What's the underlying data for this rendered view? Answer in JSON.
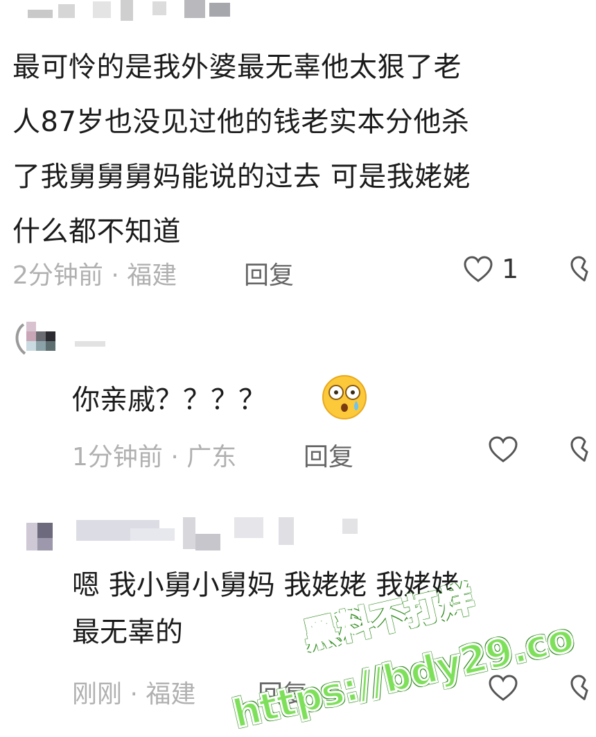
{
  "comment_1": {
    "lines": [
      "最可怜的是我外婆最无辜他太狠了老",
      "人87岁也没见过他的钱老实本分他杀",
      "了我舅舅舅妈能说的过去 可是我姥姥",
      "什么都不知道"
    ],
    "meta": "2分钟前 · 福建",
    "reply_label": "回复",
    "like_count": "1"
  },
  "comment_2": {
    "text": "你亲戚？？？？",
    "emoji": "flushed-face-emoji",
    "meta": "1分钟前 · 广东",
    "reply_label": "回复"
  },
  "comment_3": {
    "lines": [
      "嗯  我小舅小舅妈  我姥姥  我姥姥",
      "最无辜的"
    ],
    "meta": "刚刚 · 福建",
    "reply_label": "回复"
  },
  "watermark": {
    "line1": "黑料不打烊",
    "line2": "https://bdy29.co"
  },
  "icons": {
    "like": "heart-outline-icon",
    "dislike": "broken-heart-icon"
  },
  "colors": {
    "watermark_fill": "#7ee05a",
    "meta_text": "#b0b0b0",
    "reply_text": "#666666"
  }
}
